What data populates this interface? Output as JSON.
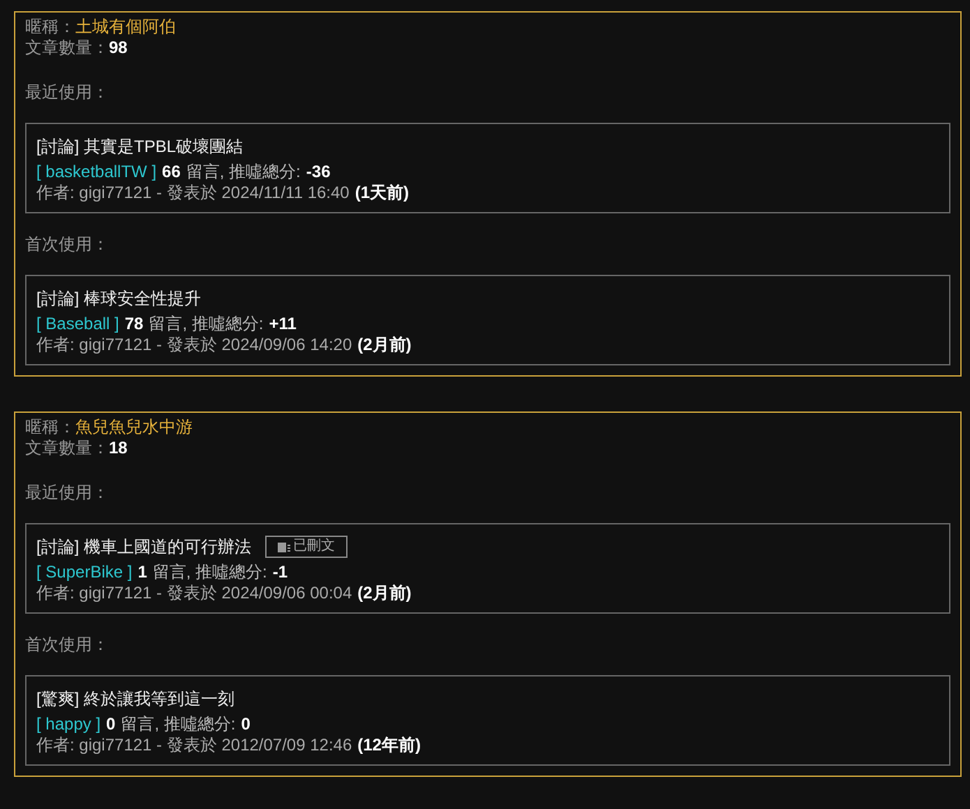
{
  "users": [
    {
      "nickname_label": "暱稱：",
      "nickname": "土城有個阿伯",
      "count_label": "文章數量：",
      "count": "98",
      "recent_label": "最近使用：",
      "first_label": "首次使用：",
      "recent": {
        "title": "[討論] 其實是TPBL破壞團結",
        "board": "[ basketballTW ]",
        "comments": "66",
        "comments_label": "留言, 推噓總分:",
        "score": "-36",
        "author_line": "作者: gigi77121 - 發表於 2024/11/11 16:40",
        "age": "(1天前)"
      },
      "first": {
        "title": "[討論] 棒球安全性提升",
        "board": "[ Baseball ]",
        "comments": "78",
        "comments_label": "留言, 推噓總分:",
        "score": "+11",
        "author_line": "作者: gigi77121 - 發表於 2024/09/06 14:20",
        "age": "(2月前)"
      }
    },
    {
      "nickname_label": "暱稱：",
      "nickname": "魚兒魚兒水中游",
      "count_label": "文章數量：",
      "count": "18",
      "recent_label": "最近使用：",
      "first_label": "首次使用：",
      "recent": {
        "title": "[討論] 機車上國道的可行辦法",
        "badge": "已刪文",
        "board": "[ SuperBike ]",
        "comments": "1",
        "comments_label": "留言, 推噓總分:",
        "score": "-1",
        "author_line": "作者: gigi77121 - 發表於 2024/09/06 00:04",
        "age": "(2月前)"
      },
      "first": {
        "title": "[驚爽] 終於讓我等到這一刻",
        "board": "[ happy ]",
        "comments": "0",
        "comments_label": "留言, 推噓總分:",
        "score": "0",
        "author_line": "作者: gigi77121 - 發表於 2012/07/09 12:46",
        "age": "(12年前)"
      }
    }
  ]
}
